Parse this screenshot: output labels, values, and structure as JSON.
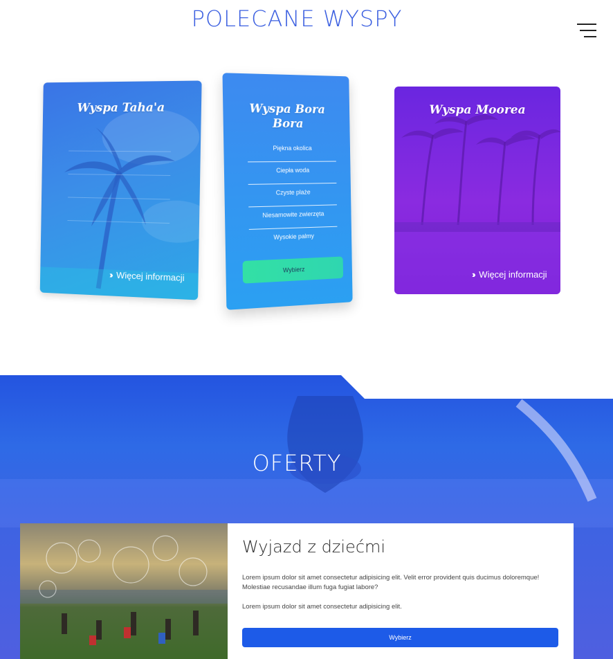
{
  "header": {
    "title": "POLECANE WYSPY",
    "menu_icon": "hamburger-menu-icon"
  },
  "islands": [
    {
      "name": "Wyspa Taha'a",
      "more_label": "Więcej informacji",
      "more_icon": "double-chevron-right-icon"
    },
    {
      "name": "Wyspa Bora Bora",
      "features": [
        "Piękna okolica",
        "Ciepła woda",
        "Czyste plaże",
        "Niesamowite zwierzęta",
        "Wysokie palmy"
      ],
      "select_label": "Wybierz"
    },
    {
      "name": "Wyspa Moorea",
      "more_label": "Więcej informacji",
      "more_icon": "double-chevron-right-icon"
    }
  ],
  "offers": {
    "title": "OFERTY",
    "card": {
      "heading": "Wyjazd z dziećmi",
      "paragraph1": "Lorem ipsum dolor sit amet consectetur adipisicing elit. Velit error provident quis ducimus doloremque! Molestiae recusandae illum fuga fugiat labore?",
      "paragraph2": "Lorem ipsum dolor sit amet consectetur adipisicing elit.",
      "button_label": "Wybierz"
    }
  },
  "colors": {
    "title_blue": "#3b5fe0",
    "offers_blue": "#2454e0",
    "moorea_purple": "#7d1fd8",
    "select_green": "#33e0a5",
    "button_blue": "#1d5be8"
  }
}
